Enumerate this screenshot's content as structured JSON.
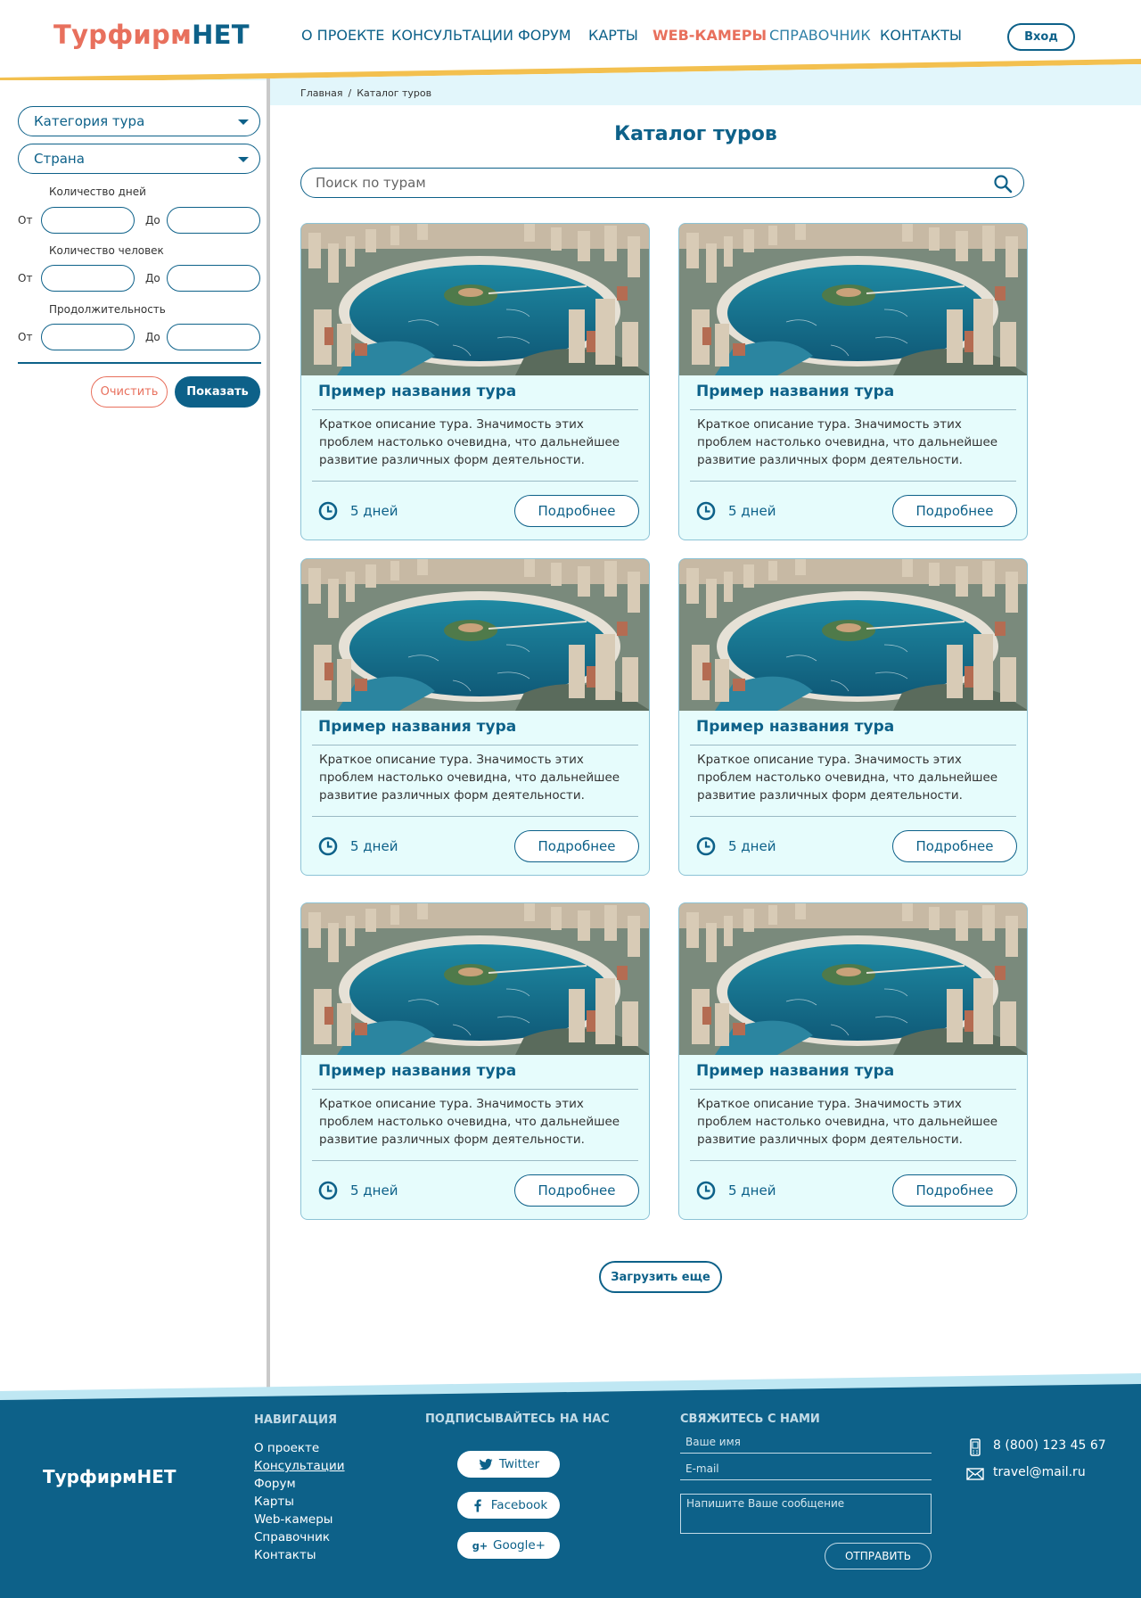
{
  "header": {
    "logo_part1": "Турфирм",
    "logo_part2": "НЕТ",
    "nav": [
      "О ПРОЕКТЕ",
      "КОНСУЛЬТАЦИИ",
      "ФОРУМ",
      "КАРТЫ",
      "WEB-КАМЕРЫ",
      "СПРАВОЧНИК",
      "КОНТАКТЫ"
    ],
    "login_label": "Вход"
  },
  "filters": {
    "category": "Категория тура",
    "country": "Страна",
    "days_label": "Количество дней",
    "people_label": "Количество человек",
    "duration_label": "Продолжительность",
    "from": "От",
    "to": "До",
    "clear_label": "Очистить",
    "show_label": "Показать"
  },
  "breadcrumb": {
    "home": "Главная",
    "sep": "/",
    "current": "Каталог туров"
  },
  "page_title": "Каталог туров",
  "search": {
    "placeholder": "Поиск по турам"
  },
  "cards": [
    {
      "title": "Пример названия тура",
      "desc": "Краткое описание тура. Значимость этих проблем настолько очевидна, что дальнейшее развитие различных форм деятельности.",
      "days": "5 дней",
      "more": "Подробнее"
    },
    {
      "title": "Пример названия тура",
      "desc": "Краткое описание тура. Значимость этих проблем настолько очевидна, что дальнейшее развитие различных форм деятельности.",
      "days": "5 дней",
      "more": "Подробнее"
    },
    {
      "title": "Пример названия тура",
      "desc": "Краткое описание тура. Значимость этих проблем настолько очевидна, что дальнейшее развитие различных форм деятельности.",
      "days": "5 дней",
      "more": "Подробнее"
    },
    {
      "title": "Пример названия тура",
      "desc": "Краткое описание тура. Значимость этих проблем настолько очевидна, что дальнейшее развитие различных форм деятельности.",
      "days": "5 дней",
      "more": "Подробнее"
    },
    {
      "title": "Пример названия тура",
      "desc": "Краткое описание тура. Значимость этих проблем настолько очевидна, что дальнейшее развитие различных форм деятельности.",
      "days": "5 дней",
      "more": "Подробнее"
    },
    {
      "title": "Пример названия тура",
      "desc": "Краткое описание тура. Значимость этих проблем настолько очевидна, что дальнейшее развитие различных форм деятельности.",
      "days": "5 дней",
      "more": "Подробнее"
    }
  ],
  "load_more": "Загрузить еще",
  "footer": {
    "logo": "ТурфирмНЕТ",
    "nav_heading": "НАВИГАЦИЯ",
    "nav": [
      "О проекте",
      "Консультации",
      "Форум",
      "Карты",
      "Web-камеры",
      "Справочник",
      "Контакты"
    ],
    "social_heading": "ПОДПИСЫВАЙТЕСЬ НА НАС",
    "social": [
      "Twitter",
      "Facebook",
      "Google+"
    ],
    "contact_heading": "СВЯЖИТЕСЬ С НАМИ",
    "name_placeholder": "Ваше имя",
    "email_placeholder": "E-mail",
    "message_placeholder": "Напишите Ваше сообщение",
    "send_label": "ОТПРАВИТЬ",
    "phone": "8 (800) 123 45 67",
    "email": "travel@mail.ru"
  },
  "colors": {
    "primary": "#0d6189",
    "accent": "#e8705d",
    "card_bg": "#e6fcfc",
    "stripe": "#f3c04f"
  }
}
